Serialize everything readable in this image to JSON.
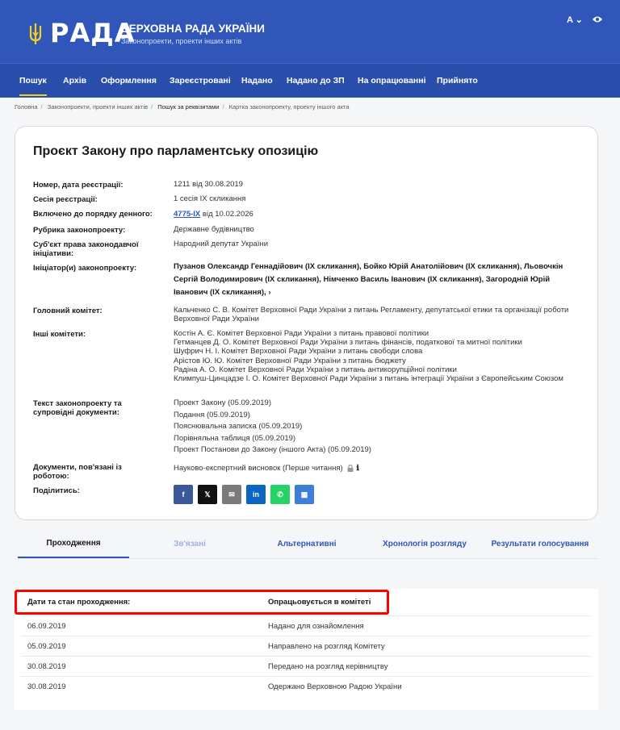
{
  "header": {
    "logo_text": "РАДА",
    "title": "Верховна Рада України",
    "subtitle": "Законопроекти, проекти інших актів",
    "lang_label": "A ⌄"
  },
  "nav": [
    {
      "label": "Пошук"
    },
    {
      "label": "Архів"
    },
    {
      "label": "Оформлення"
    },
    {
      "label": "Зареєстровані"
    },
    {
      "label": "Надано"
    },
    {
      "label": "Надано до ЗП"
    },
    {
      "label": "На опрацюванні"
    },
    {
      "label": "Прийнято"
    }
  ],
  "breadcrumbs": [
    {
      "label": "Головна"
    },
    {
      "label": "Законопроекти, проекти інших актів"
    },
    {
      "label": "Пошук за реквізитами"
    },
    {
      "label": "Картка законопроекту, проекту іншого акта"
    }
  ],
  "card": {
    "title": "Проєкт Закону про парламентську опозицію",
    "fields": {
      "number_label": "Номер, дата реєстрації:",
      "number_value": "1211 від 30.08.2019",
      "session_label": "Сесія реєстрації:",
      "session_value": "1 сесія IX скликання",
      "agenda_label": "Включено до порядку денного:",
      "agenda_link": "4775-IX",
      "agenda_date": " від 10.02.2026",
      "rubric_label": "Рубрика законопроекту:",
      "rubric_value": "Державне будівництво",
      "subject_label": "Суб'єкт права законодавчої ініціативи:",
      "subject_value": "Народний депутат України",
      "initiators_label": "Ініціатор(и) законопроекту:",
      "initiators_value": "Пузанов Олександр Геннадійович (IX скликання), Бойко Юрій Анатолійович (IX скликання), Льовочкін Сергій Володимирович (IX скликання), Німченко Василь Іванович (IX скликання), Загородній Юрій Іванович (IX скликання),  ›",
      "main_committee_label": "Головний комітет:",
      "main_committee_value": "Кальченко С. В. Комітет Верховної Ради України з питань Регламенту, депутатської етики та організації роботи Верховної Ради України",
      "other_committees_label": "Інші комітети:",
      "other_committees": [
        "Костін А. Є. Комітет Верховної Ради України з питань правової політики",
        "Гетманцев Д. О. Комітет Верховної Ради України з питань фінансів, податкової та митної політики",
        "Шуфрич Н. І. Комітет Верховної Ради України з питань свободи слова",
        "Арістов Ю. Ю. Комітет Верховної Ради України з питань бюджету",
        "Радіна А. О. Комітет Верховної Ради України з питань антикорупційної політики",
        "Климпуш-Цинцадзе І. О. Комітет Верховної Ради України з питань інтеграції України з Європейським Союзом"
      ],
      "docs_label": "Текст законопроекту та супровідні документи:",
      "docs": [
        "Проект Закону (05.09.2019)",
        "Подання (05.09.2019)",
        "Пояснювальна записка (05.09.2019)",
        "Порівняльна таблиця (05.09.2019)",
        "Проект Постанови до Закону (іншого Акта) (05.09.2019)"
      ],
      "related_docs_label": "Документи, пов'язані із роботою:",
      "related_docs_value": "Науково-експертний висновок (Перше читання)",
      "share_label": "Поділитись:"
    },
    "share": [
      {
        "name": "facebook",
        "glyph": "f",
        "color": "#3b5998"
      },
      {
        "name": "x",
        "glyph": "𝕏",
        "color": "#111111"
      },
      {
        "name": "email",
        "glyph": "✉",
        "color": "#7a7a7a"
      },
      {
        "name": "linkedin",
        "glyph": "in",
        "color": "#0a66c2"
      },
      {
        "name": "whatsapp",
        "glyph": "✆",
        "color": "#25d366"
      },
      {
        "name": "qr",
        "glyph": "▦",
        "color": "#3d7ed8"
      }
    ]
  },
  "tabs": [
    {
      "label": "Проходження"
    },
    {
      "label": "Зв'язані"
    },
    {
      "label": "Альтернативні"
    },
    {
      "label": "Хронологія розгляду"
    },
    {
      "label": "Результати голосування"
    }
  ],
  "passage": {
    "header_label": "Дати та стан проходження:",
    "current_status": "Опрацьовується в комітеті",
    "rows": [
      {
        "date": "06.09.2019",
        "status": "Надано для ознайомлення"
      },
      {
        "date": "05.09.2019",
        "status": "Направлено на розгляд Комітету"
      },
      {
        "date": "30.08.2019",
        "status": "Передано на розгляд керівництву"
      },
      {
        "date": "30.08.2019",
        "status": "Одержано Верховною Радою України"
      }
    ]
  }
}
